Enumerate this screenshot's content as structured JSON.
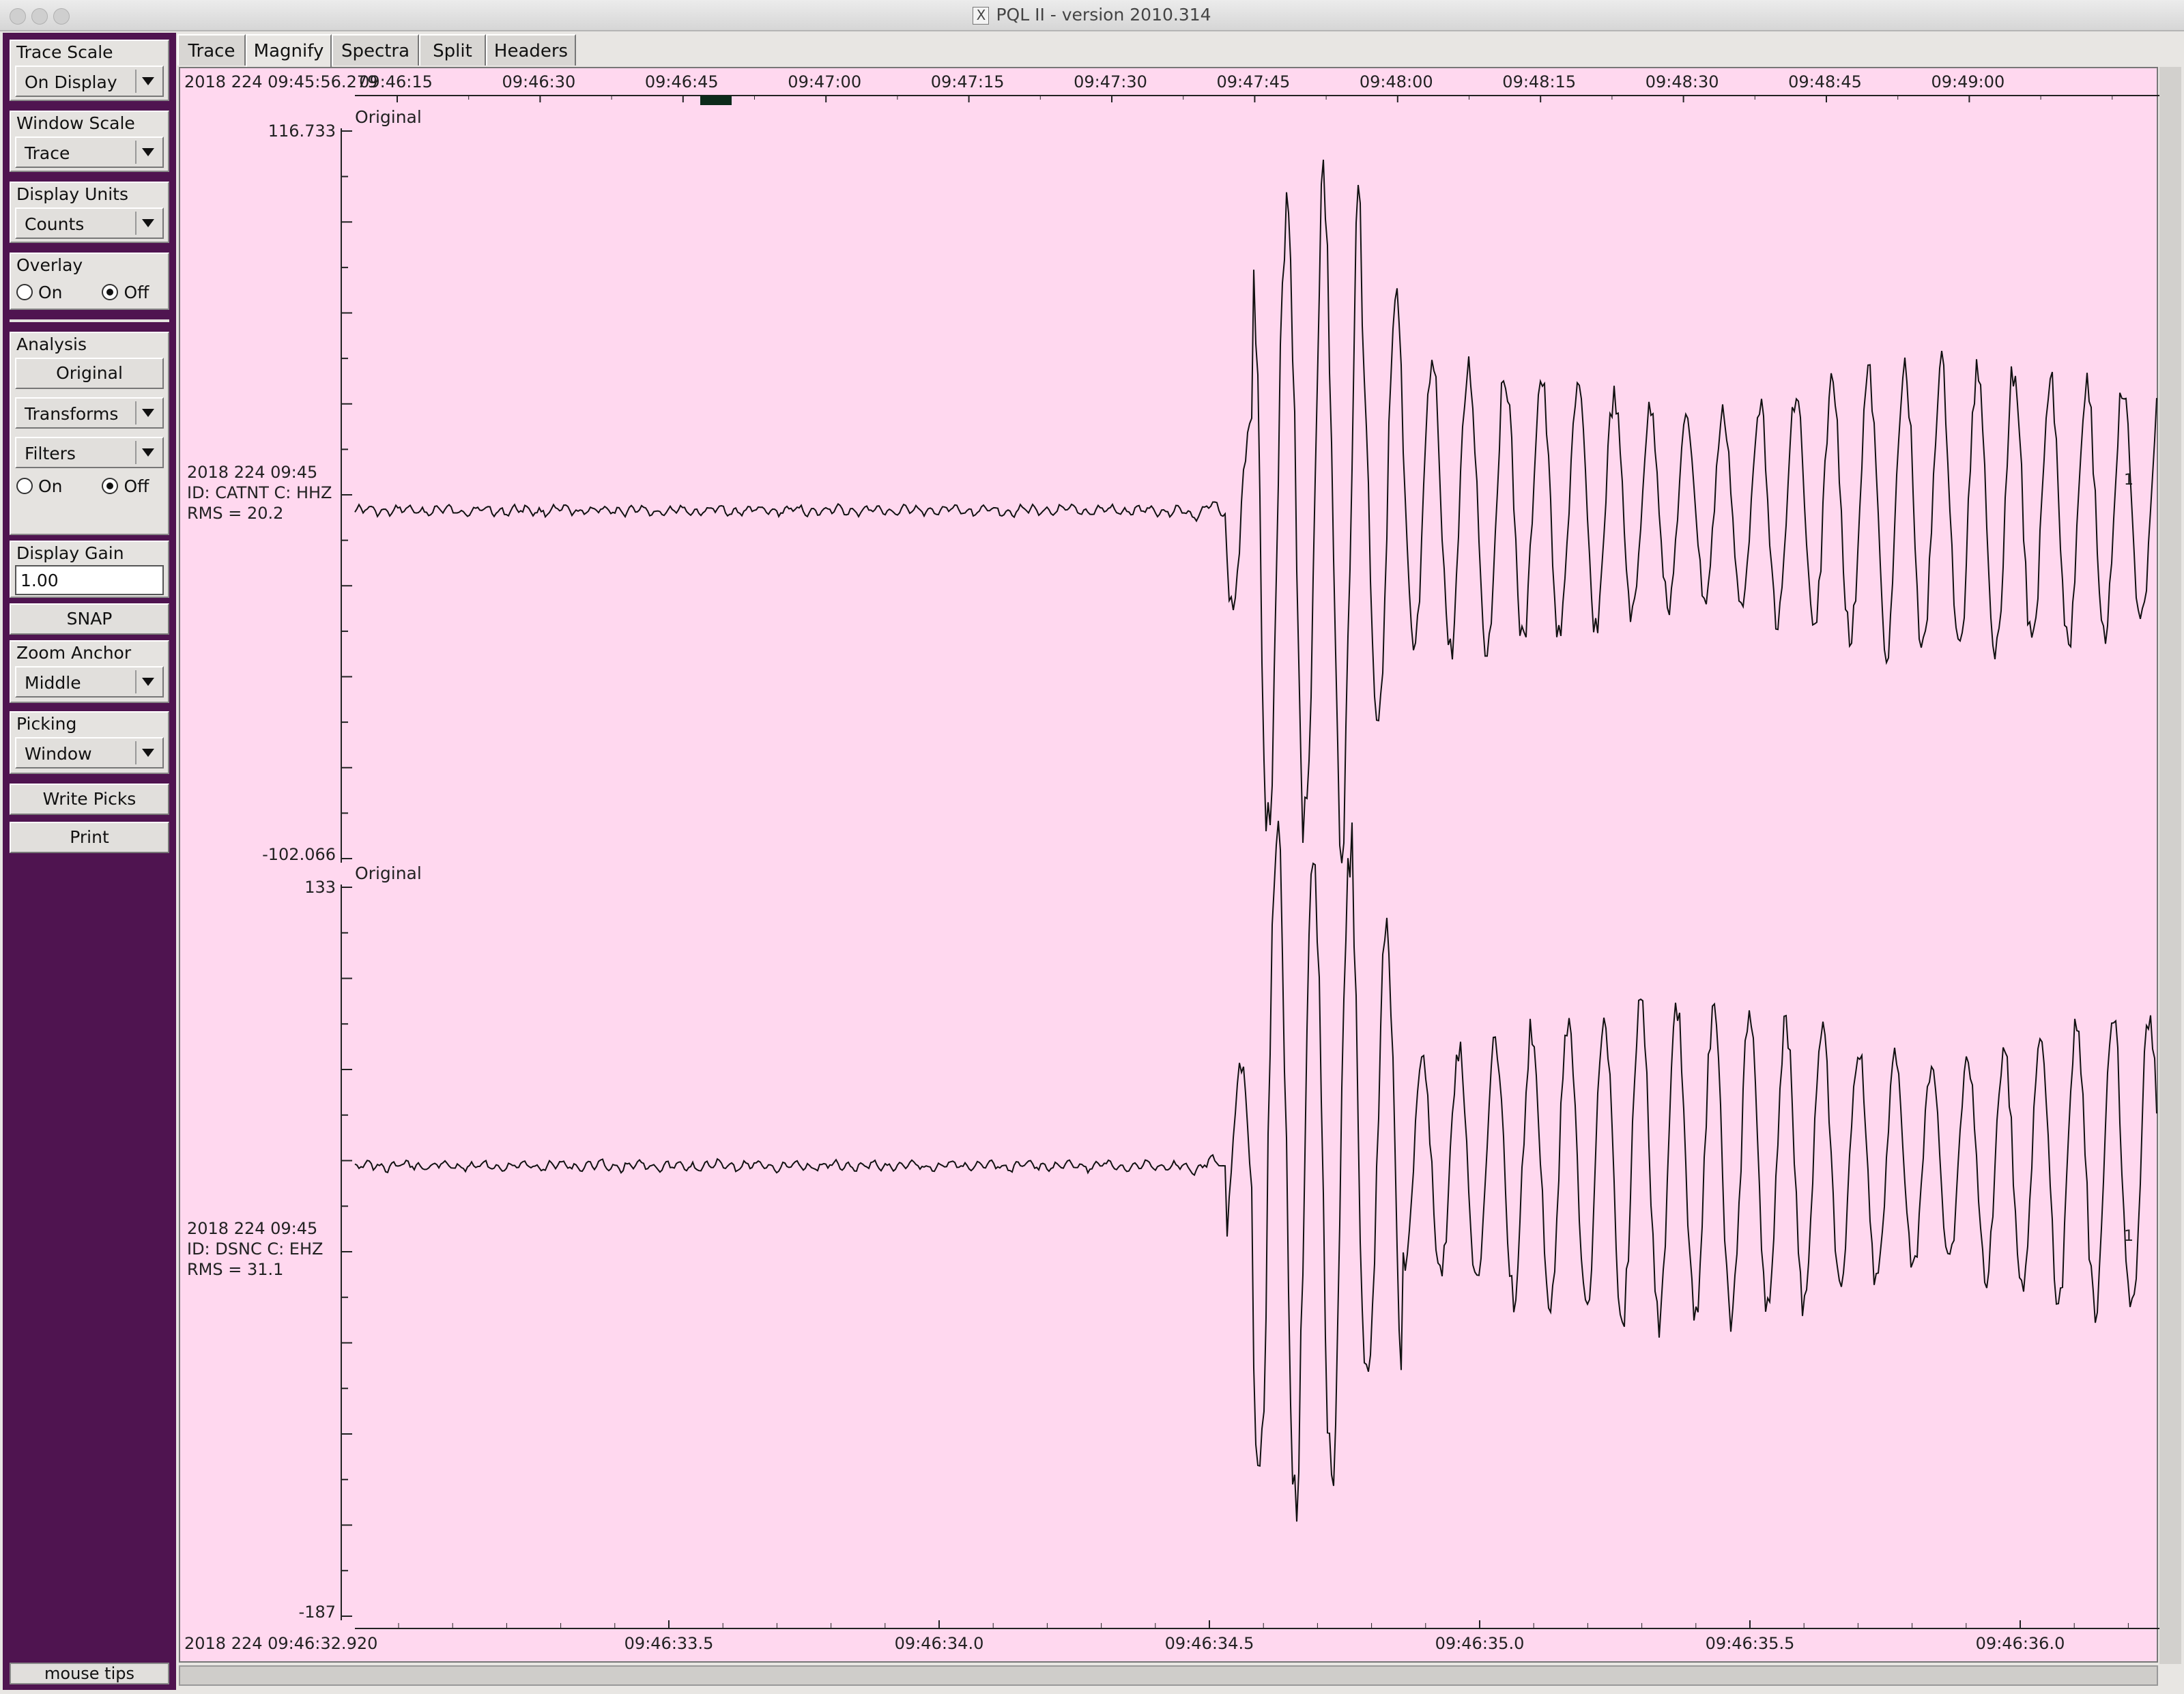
{
  "window": {
    "title_icon": "X",
    "title": "PQL II - version 2010.314"
  },
  "sidebar": {
    "trace_scale": {
      "label": "Trace Scale",
      "value": "On Display"
    },
    "window_scale": {
      "label": "Window Scale",
      "value": "Trace"
    },
    "display_units": {
      "label": "Display Units",
      "value": "Counts"
    },
    "overlay": {
      "label": "Overlay",
      "on": "On",
      "off": "Off",
      "selected": "Off"
    },
    "analysis": {
      "label": "Analysis",
      "original": "Original",
      "transforms": "Transforms",
      "filters": "Filters",
      "on": "On",
      "off": "Off",
      "selected": "Off"
    },
    "display_gain": {
      "label": "Display Gain",
      "value": "1.00"
    },
    "snap": "SNAP",
    "zoom_anchor": {
      "label": "Zoom Anchor",
      "value": "Middle"
    },
    "picking": {
      "label": "Picking",
      "value": "Window"
    },
    "write_picks": "Write Picks",
    "print": "Print",
    "mouse_tips": "mouse tips"
  },
  "tabs": [
    "Trace",
    "Magnify",
    "Spectra",
    "Split",
    "Headers"
  ],
  "active_tab": "Magnify",
  "plot": {
    "top_axis": {
      "start_label": "2018 224 09:45:56.279",
      "ticks": [
        "09:46:15",
        "09:46:30",
        "09:46:45",
        "09:47:00",
        "09:47:15",
        "09:47:30",
        "09:47:45",
        "09:48:00",
        "09:48:15",
        "09:48:30",
        "09:48:45",
        "09:49:00"
      ]
    },
    "bottom_axis": {
      "start_label": "2018 224 09:46:32.920",
      "ticks": [
        "09:46:33.5",
        "09:46:34.0",
        "09:46:34.5",
        "09:46:35.0",
        "09:46:35.5",
        "09:46:36.0"
      ]
    },
    "traces": [
      {
        "tag": "Original",
        "ymax": "116.733",
        "ymin": "-102.066",
        "info": [
          "2018 224 09:45",
          "ID: CATNT C: HHZ",
          "RMS = 20.2"
        ],
        "end_marker": "1"
      },
      {
        "tag": "Original",
        "ymax": "133",
        "ymin": "-187",
        "info": [
          "2018 224 09:45",
          "ID: DSNC C: EHZ",
          "RMS = 31.1"
        ],
        "end_marker": "1"
      }
    ]
  },
  "colors": {
    "sidebar": "#4f1450",
    "plot_bg": "#ffd8ef",
    "trace": "#111111",
    "window_marker": "#0c2a1a"
  }
}
